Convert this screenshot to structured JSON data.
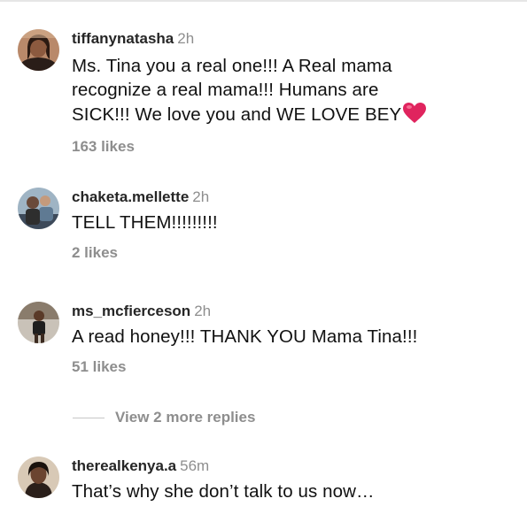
{
  "comments": [
    {
      "username": "tiffanynatasha",
      "time": "2h",
      "text_lines": [
        "Ms. Tina you a real one!!! A Real mama",
        "recognize a real mama!!! Humans are",
        "SICK!!! We love you and WE LOVE BEY"
      ],
      "emoji": "red-heart-emoji",
      "likes": "163 likes"
    },
    {
      "username": "chaketa.mellette",
      "time": "2h",
      "text_lines": [
        "TELL THEM!!!!!!!!!"
      ],
      "likes": "2 likes"
    },
    {
      "username": "ms_mcfierceson",
      "time": "2h",
      "text_lines": [
        "A read honey!!! THANK YOU Mama Tina!!!"
      ],
      "likes": "51 likes"
    },
    {
      "username": "therealkenya.a",
      "time": "56m",
      "text_lines": [
        "That’s why she don’t talk to us now…"
      ]
    }
  ],
  "replies": {
    "label": "View 2 more replies"
  },
  "colors": {
    "username": "#262626",
    "secondary_text": "#8e8e8e",
    "body_text": "#111111",
    "heart": "#e0245e",
    "divider": "#c7c7c7"
  }
}
